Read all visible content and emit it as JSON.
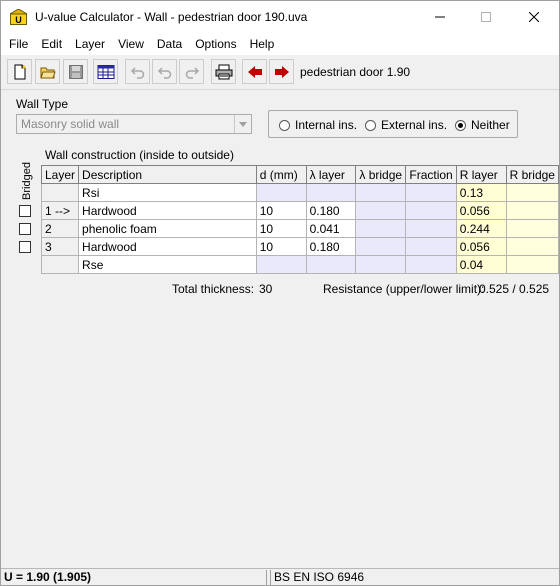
{
  "window": {
    "title": "U-value Calculator - Wall - pedestrian door 190.uva"
  },
  "menu": [
    "File",
    "Edit",
    "Layer",
    "View",
    "Data",
    "Options",
    "Help"
  ],
  "toolbar": {
    "document_name": "pedestrian door 1.90",
    "colors": {
      "arrow": "#c00000"
    }
  },
  "wall_type": {
    "label": "Wall Type",
    "value": "Masonry solid wall"
  },
  "insulation": {
    "options": [
      "Internal ins.",
      "External ins.",
      "Neither"
    ],
    "selected": "Neither"
  },
  "construction": {
    "label": "Wall construction (inside to outside)",
    "bridged_label": "Bridged",
    "columns": [
      "Layer",
      "Description",
      "d (mm)",
      "λ layer",
      "λ bridge",
      "Fraction",
      "R layer",
      "R bridge"
    ],
    "rows": [
      {
        "layer": "",
        "description": "Rsi",
        "d": "",
        "lambda": "",
        "lambda_bridge": "",
        "fraction": "",
        "r_layer": "0.13",
        "r_bridge": ""
      },
      {
        "layer": "1 -->",
        "description": "Hardwood",
        "d": "10",
        "lambda": "0.180",
        "lambda_bridge": "",
        "fraction": "",
        "r_layer": "0.056",
        "r_bridge": ""
      },
      {
        "layer": "2",
        "description": "phenolic foam",
        "d": "10",
        "lambda": "0.041",
        "lambda_bridge": "",
        "fraction": "",
        "r_layer": "0.244",
        "r_bridge": ""
      },
      {
        "layer": "3",
        "description": "Hardwood",
        "d": "10",
        "lambda": "0.180",
        "lambda_bridge": "",
        "fraction": "",
        "r_layer": "0.056",
        "r_bridge": ""
      },
      {
        "layer": "",
        "description": "Rse",
        "d": "",
        "lambda": "",
        "lambda_bridge": "",
        "fraction": "",
        "r_layer": "0.04",
        "r_bridge": ""
      }
    ]
  },
  "totals": {
    "thickness_label": "Total thickness:",
    "thickness_value": "30",
    "resistance_label": "Resistance (upper/lower limit):",
    "resistance_value": "0.525 / 0.525"
  },
  "status": {
    "u_value": "U = 1.90  (1.905)",
    "standard": "BS EN ISO 6946"
  }
}
